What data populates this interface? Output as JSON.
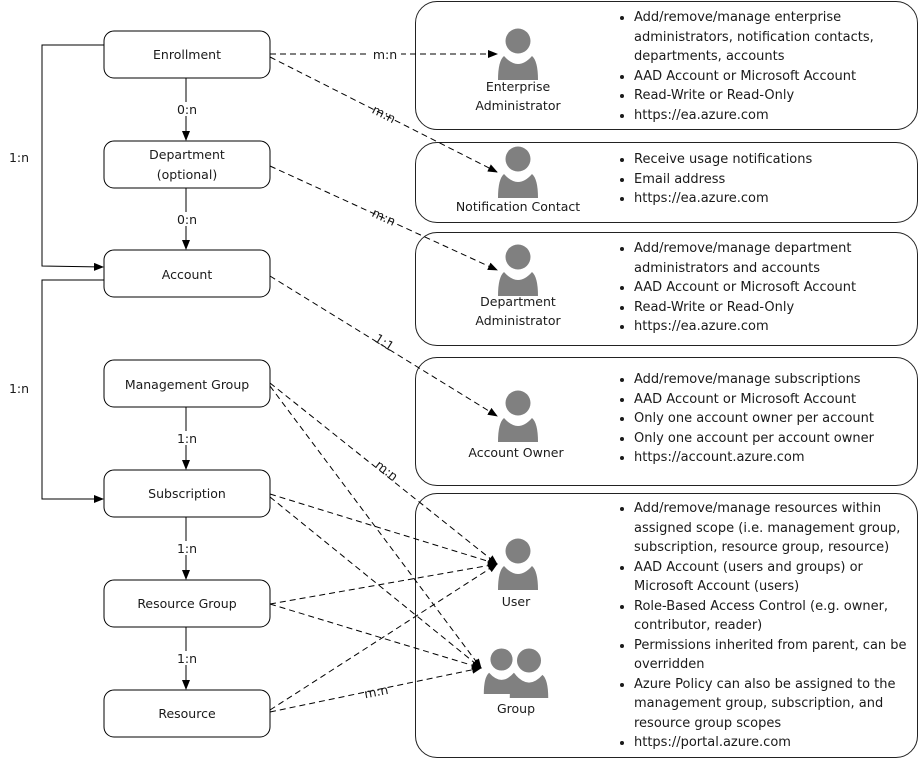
{
  "entities": [
    {
      "id": "enrollment",
      "label": "Enrollment"
    },
    {
      "id": "department",
      "label": "Department",
      "sublabel": "(optional)"
    },
    {
      "id": "account",
      "label": "Account"
    },
    {
      "id": "management-group",
      "label": "Management Group"
    },
    {
      "id": "subscription",
      "label": "Subscription"
    },
    {
      "id": "resource-group",
      "label": "Resource Group"
    },
    {
      "id": "resource",
      "label": "Resource"
    }
  ],
  "relations": {
    "enrollment_department": "0:n",
    "department_account": "0:n",
    "enrollment_account": "1:n",
    "account_subscription": "1:n",
    "mg_subscription": "1:n",
    "subscription_rg": "1:n",
    "rg_resource": "1:n",
    "enrollment_ea": "m:n",
    "enrollment_notification": "m:n",
    "department_admin": "m:n",
    "account_owner": "1:1",
    "scope_user": "m:n",
    "scope_group": "m:n"
  },
  "roles": [
    {
      "label": "Enterprise Administrator",
      "line1": "Enterprise",
      "line2": "Administrator",
      "icon": "person-icon",
      "bullets": [
        "Add/remove/manage enterprise administrators, notification contacts, departments, accounts",
        "AAD Account or Microsoft Account",
        "Read-Write or Read-Only",
        "https://ea.azure.com"
      ]
    },
    {
      "label": "Notification Contact",
      "icon": "person-icon",
      "bullets": [
        "Receive usage notifications",
        "Email address",
        "https://ea.azure.com"
      ]
    },
    {
      "line1": "Department",
      "line2": "Administrator",
      "icon": "person-icon",
      "bullets": [
        "Add/remove/manage department administrators and accounts",
        "AAD Account or Microsoft Account",
        "Read-Write or Read-Only",
        "https://ea.azure.com"
      ]
    },
    {
      "label": "Account Owner",
      "icon": "person-icon",
      "bullets": [
        "Add/remove/manage subscriptions",
        "AAD Account or Microsoft Account",
        "Only one account owner per account",
        "Only one account per account owner",
        "https://account.azure.com"
      ]
    },
    {
      "user_label": "User",
      "group_label": "Group",
      "icon": "person-icon",
      "bullets": [
        "Add/remove/manage resources within assigned scope (i.e. management group, subscription, resource group, resource)",
        "AAD Account (users and groups) or Microsoft Account (users)",
        "Role-Based Access Control (e.g. owner, contributor, reader)",
        "Permissions inherited from parent, can be overridden",
        "Azure Policy can also be assigned to the management group, subscription, and resource group scopes",
        "https://portal.azure.com"
      ]
    }
  ],
  "colors": {
    "icon": "#808080",
    "line": "#000000"
  }
}
